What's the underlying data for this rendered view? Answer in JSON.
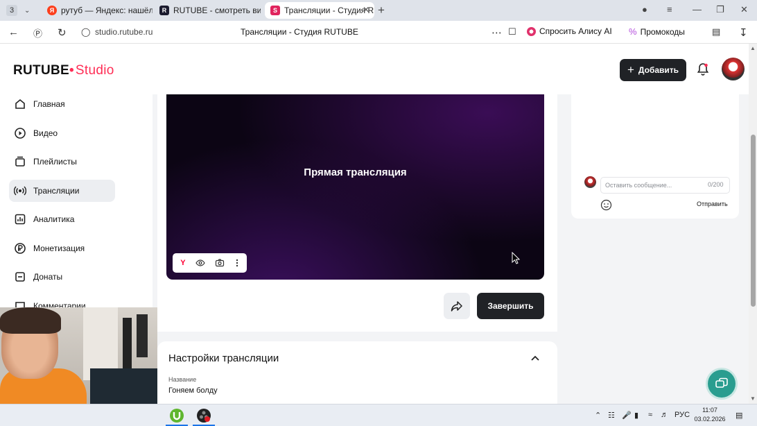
{
  "browser": {
    "tab_count": "3",
    "tabs": [
      {
        "label": "рутуб — Яндекс: нашёлся",
        "active": false
      },
      {
        "label": "RUTUBE - смотреть виде",
        "active": false
      },
      {
        "label": "Трансляции - Студия R",
        "active": true
      }
    ],
    "url": "studio.rutube.ru",
    "page_title": "Трансляции - Студия RUTUBE",
    "alisa_label": "Спросить Алису AI",
    "promo_label": "Промокоды"
  },
  "header": {
    "logo_main": "RUTUBE",
    "logo_studio": "Studio",
    "add_button": "Добавить"
  },
  "sidebar": {
    "items": [
      {
        "label": "Главная",
        "icon": "home-icon",
        "active": false
      },
      {
        "label": "Видео",
        "icon": "video-icon",
        "active": false
      },
      {
        "label": "Плейлисты",
        "icon": "playlist-icon",
        "active": false
      },
      {
        "label": "Трансляции",
        "icon": "broadcast-icon",
        "active": true
      },
      {
        "label": "Аналитика",
        "icon": "analytics-icon",
        "active": false
      },
      {
        "label": "Монетизация",
        "icon": "monetization-icon",
        "active": false
      },
      {
        "label": "Донаты",
        "icon": "donate-icon",
        "active": false
      },
      {
        "label": "Комментарии",
        "icon": "comments-icon",
        "active": false
      }
    ]
  },
  "player": {
    "overlay_text": "Прямая трансляция",
    "tools": [
      "yandex-icon",
      "eye-icon",
      "camera-icon",
      "more-icon"
    ]
  },
  "actions": {
    "finish_button": "Завершить"
  },
  "settings": {
    "title": "Настройки трансляции",
    "name_label": "Название",
    "name_value": "Гоняем болду"
  },
  "chat": {
    "placeholder": "Оставить сообщение...",
    "counter": "0/200",
    "send_label": "Отправить"
  },
  "taskbar": {
    "language": "РУС",
    "time": "11:07",
    "date": "03.02.2026"
  },
  "colors": {
    "brand": "#ff2d55",
    "dark_button": "#202226",
    "help": "#2a9d8f"
  }
}
